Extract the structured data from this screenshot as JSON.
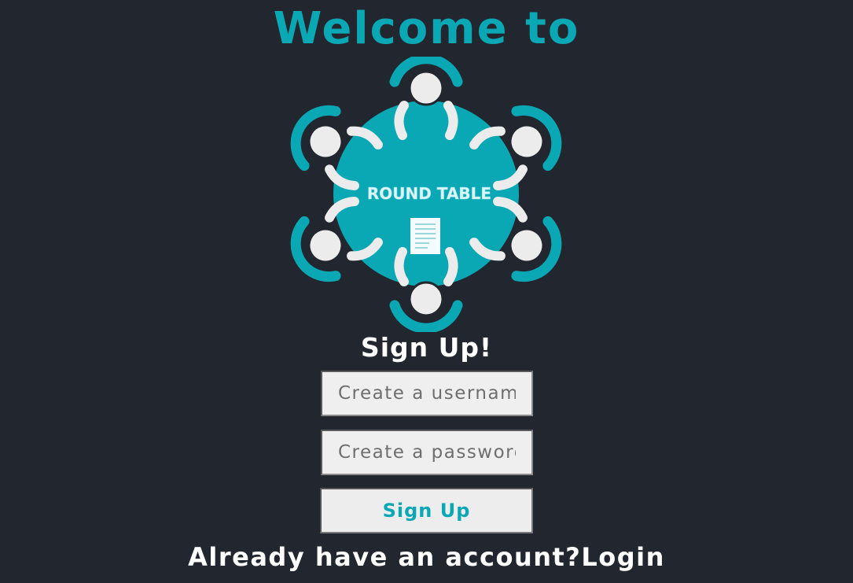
{
  "header": {
    "welcome_text": "Welcome to"
  },
  "logo": {
    "name": "ROUND TABLE",
    "icon": "round-table-logo-icon",
    "colors": {
      "teal": "#0aa8b4",
      "figure": "#ececec"
    }
  },
  "signup": {
    "heading": "Sign Up!",
    "username_placeholder": "Create a username",
    "password_placeholder": "Create a password",
    "submit_label": "Sign Up"
  },
  "footer": {
    "prompt_text": "Already have an account?",
    "login_label": "Login"
  },
  "theme": {
    "background": "#22262f",
    "accent": "#0aa8b4",
    "text": "#ffffff"
  }
}
